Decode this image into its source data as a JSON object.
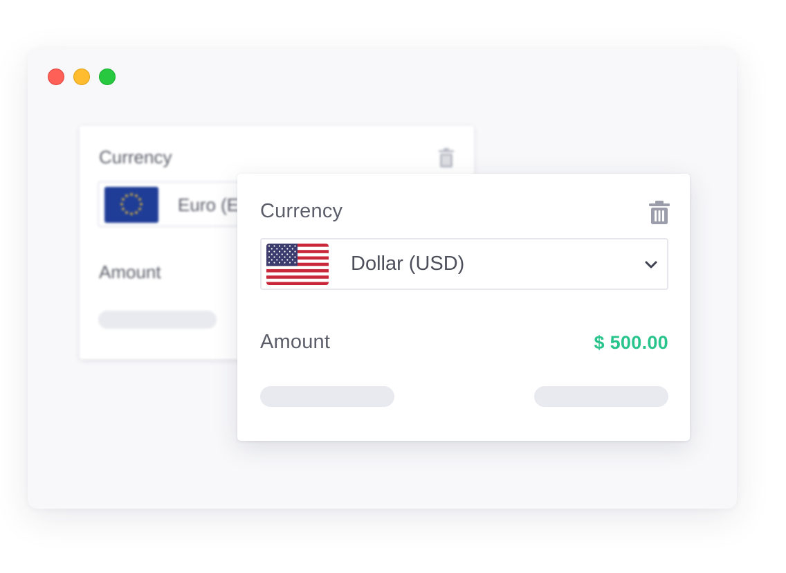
{
  "window": {
    "controls": [
      "close",
      "minimize",
      "maximize"
    ]
  },
  "background_card": {
    "currency_label": "Currency",
    "selected_currency": "Euro (E",
    "flag_icon": "eu-flag-icon",
    "amount_label": "Amount",
    "delete_icon": "trash-icon"
  },
  "front_card": {
    "currency_label": "Currency",
    "selected_currency": "Dollar (USD)",
    "flag_icon": "us-flag-icon",
    "dropdown_icon": "chevron-down-icon",
    "amount_label": "Amount",
    "amount_value": "$ 500.00",
    "delete_icon": "trash-icon"
  },
  "colors": {
    "amount": "#29c48c",
    "window_bg": "#f8f8fa",
    "placeholder": "#e9eaef",
    "close": "#fe5f57",
    "minimize": "#febc2e",
    "maximize": "#28c840"
  }
}
